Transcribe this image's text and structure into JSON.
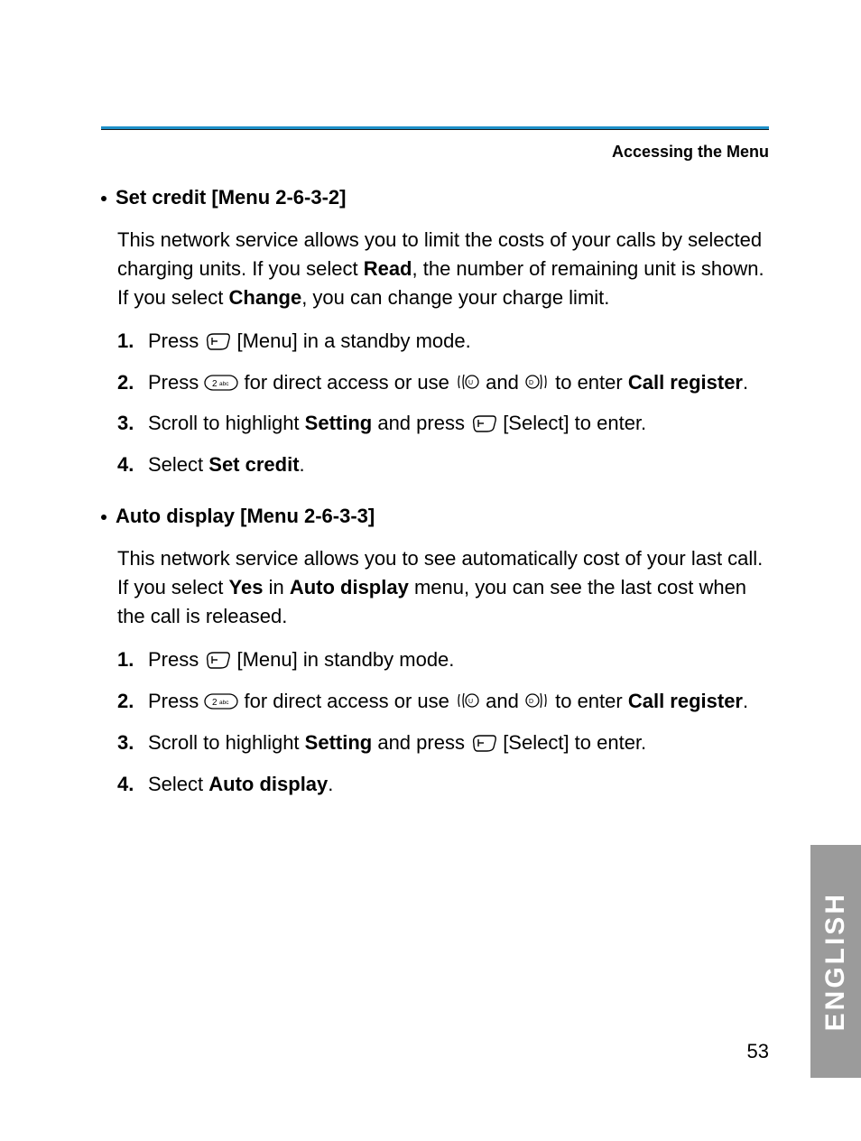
{
  "header": {
    "section": "Accessing the Menu"
  },
  "set_credit": {
    "title": "Set credit [Menu 2-6-3-2]",
    "para_pre": "This network service allows you to limit the costs of your calls by selected charging units. If you select ",
    "para_read": "Read",
    "para_mid": ", the number of remaining unit is shown. If you select ",
    "para_change": "Change",
    "para_post": ", you can change your charge limit.",
    "steps": {
      "s1_num": "1.",
      "s1_a": "Press ",
      "s1_b": "[Menu] in a standby mode.",
      "s2_num": "2.",
      "s2_a": "Press ",
      "s2_b": " for direct access or use ",
      "s2_and": " and ",
      "s2_c": " to enter ",
      "s2_call": "Call register",
      "s2_d": ".",
      "s3_num": "3.",
      "s3_a": "Scroll to highlight ",
      "s3_setting": "Setting",
      "s3_b": " and press ",
      "s3_c": "[Select] to enter.",
      "s4_num": "4.",
      "s4_a": "Select ",
      "s4_setcredit": "Set credit",
      "s4_b": "."
    }
  },
  "auto_display": {
    "title": "Auto display [Menu 2-6-3-3]",
    "para_pre": "This network service allows you to see automatically cost of your last call. If you select ",
    "para_yes": "Yes",
    "para_mid1": " in ",
    "para_autodisp": "Auto display",
    "para_mid2": " menu, you can see the last cost when the call is released.",
    "steps": {
      "s1_num": "1.",
      "s1_a": "Press ",
      "s1_b": "[Menu] in standby mode.",
      "s2_num": "2.",
      "s2_a": "Press ",
      "s2_b": " for direct access or use ",
      "s2_and": " and ",
      "s2_c": " to enter ",
      "s2_call": "Call register",
      "s2_d": ".",
      "s3_num": "3.",
      "s3_a": "Scroll to highlight ",
      "s3_setting": "Setting",
      "s3_b": " and press ",
      "s3_c": "[Select] to enter.",
      "s4_num": "4.",
      "s4_a": "Select ",
      "s4_autodisp": "Auto display",
      "s4_b": "."
    }
  },
  "footer": {
    "page_number": "53",
    "language_tab": "ENGLISH"
  },
  "icons": {
    "softkey": "left-softkey-icon",
    "key2": "key-2abc-icon",
    "rocker_left": "rocker-left-icon",
    "rocker_right": "rocker-right-icon"
  }
}
